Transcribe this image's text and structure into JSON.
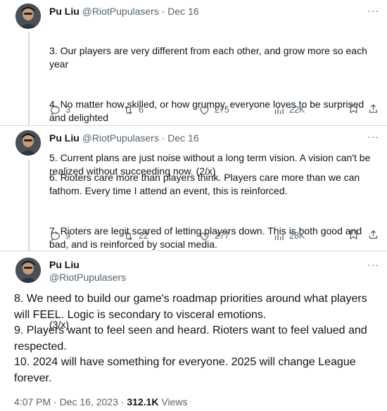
{
  "tweet1": {
    "name": "Pu Liu",
    "handle": "@RiotPupulasers",
    "separator": "·",
    "date": "Dec 16",
    "lines": [
      "3. Our players are very different from each other, and grow more so each year",
      "4. No matter how skilled, or how grumpy, everyone loves to be surprised and delighted",
      "5. Current plans are just noise without a long term vision. A vision can't be realized without succeeding now. (2/x)"
    ],
    "replies": "3",
    "reposts": "6",
    "likes": "275",
    "views": "22K"
  },
  "tweet2": {
    "name": "Pu Liu",
    "handle": "@RiotPupulasers",
    "separator": "·",
    "date": "Dec 16",
    "lines": [
      "6. Rioters care more than players think. Players care more than we can fathom. Every time I attend an event, this is reinforced.",
      "7. Rioters are legit scared of letting players down. This is both good and bad, and is reinforced by social media.",
      "",
      "(3/x)"
    ],
    "replies": "9",
    "reposts": "22",
    "likes": "277",
    "views": "28K"
  },
  "tweet3": {
    "name": "Pu Liu",
    "handle": "@RiotPupulasers",
    "lines": [
      "8. We need to build our game's roadmap priorities around what players will FEEL. Logic is secondary to visceral emotions.",
      "9. Players want to feel seen and heard. Rioters want to feel valued and respected.",
      "10. 2024 will have something for everyone. 2025 will change League forever."
    ],
    "time": "4:07 PM",
    "separator": "·",
    "full_date": "Dec 16, 2023",
    "views_count": "312.1K",
    "views_label": "Views"
  },
  "more_label": "···",
  "icons": [
    "reply-icon",
    "repost-icon",
    "like-icon",
    "views-icon",
    "bookmark-icon",
    "share-icon",
    "more-icon",
    "avatar"
  ]
}
